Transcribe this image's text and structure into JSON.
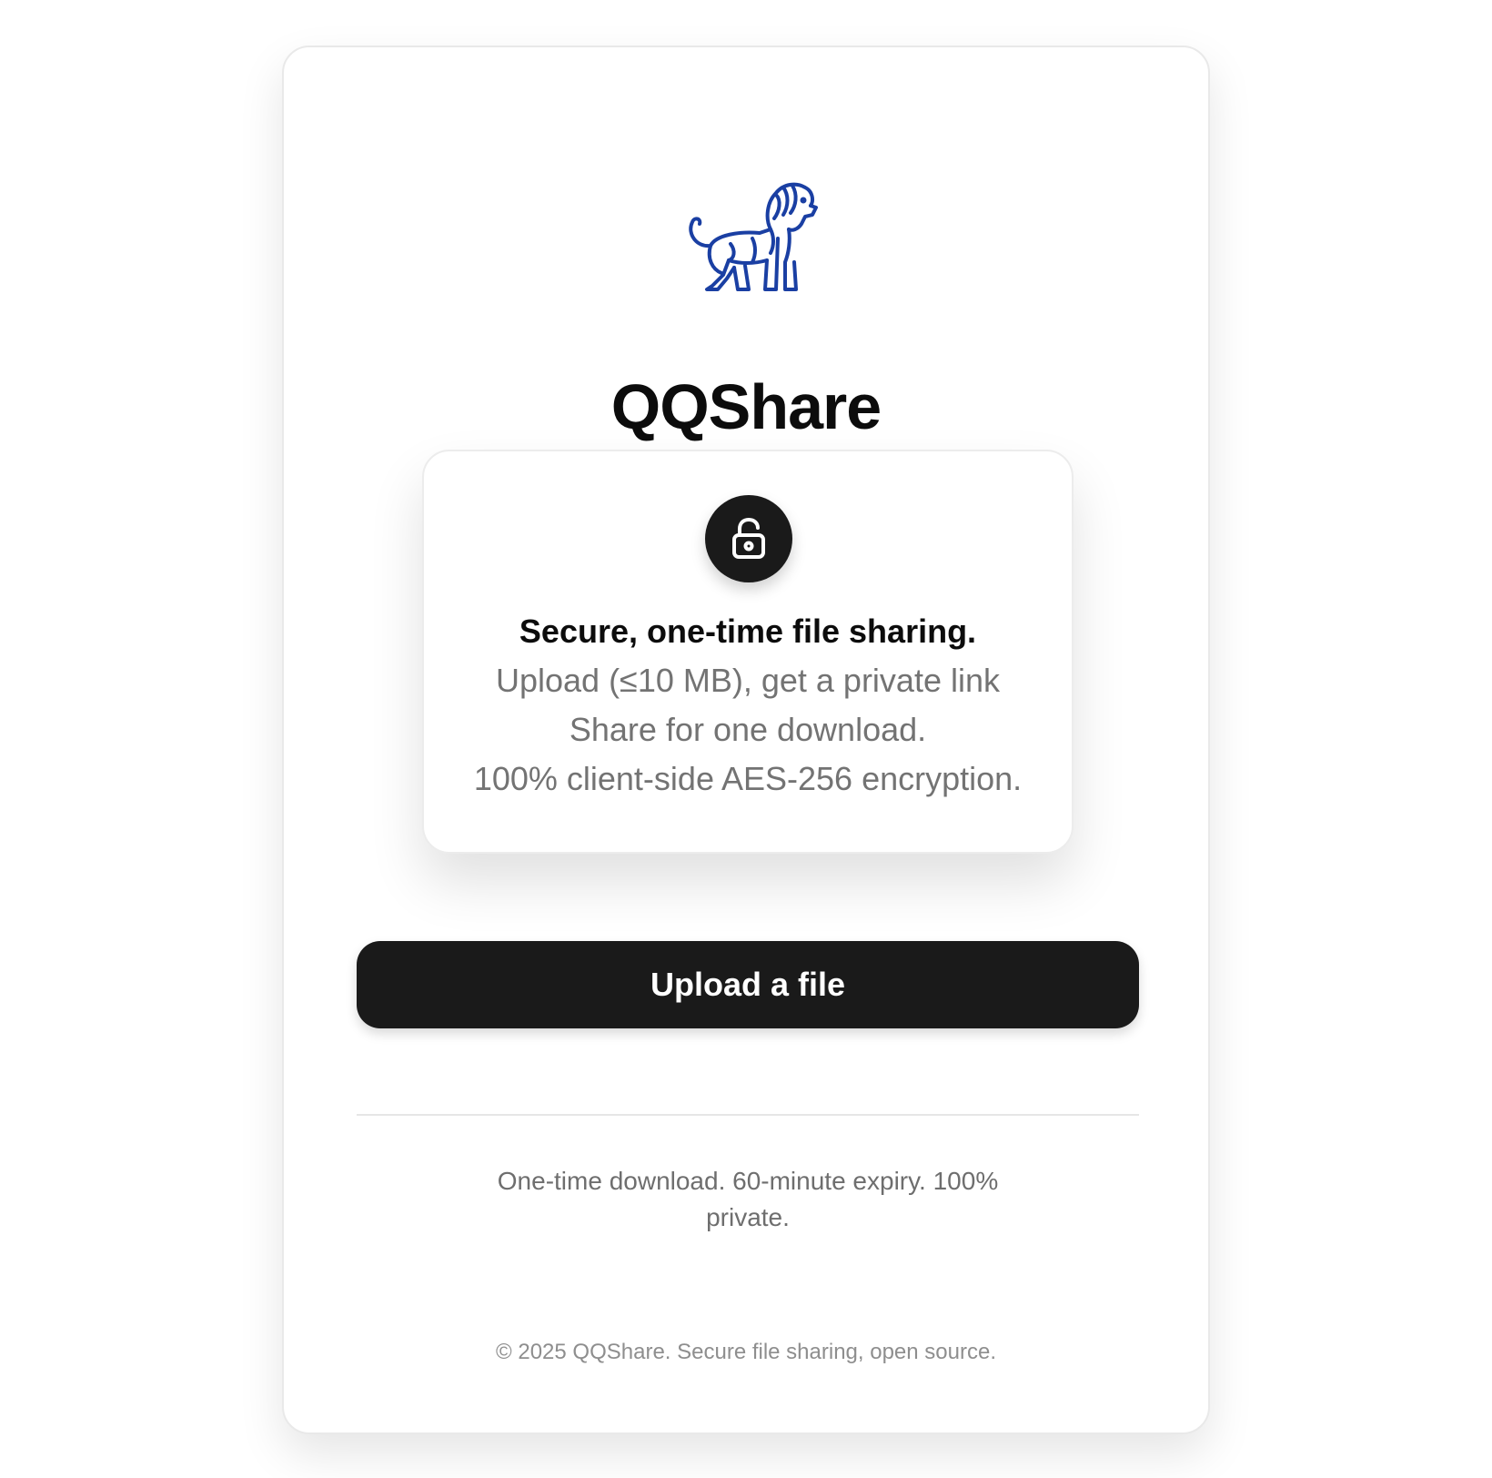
{
  "brand": {
    "name": "QQShare",
    "logo_icon": "lion-logo-icon",
    "logo_color": "#1a3fa3"
  },
  "info": {
    "icon": "unlocked-padlock-icon",
    "heading": "Secure, one-time file sharing.",
    "lines": [
      "Upload (≤10 MB), get a private link",
      "Share for one download.",
      "100% client-side AES-256 encryption."
    ]
  },
  "actions": {
    "upload_label": "Upload a file"
  },
  "footnote": "One-time download. 60-minute expiry. 100% private.",
  "footer": {
    "copyright": "© 2025 QQShare. Secure file sharing, open source."
  },
  "colors": {
    "primary": "#1a1a1a",
    "muted_text": "#737373",
    "background": "#ffffff"
  }
}
